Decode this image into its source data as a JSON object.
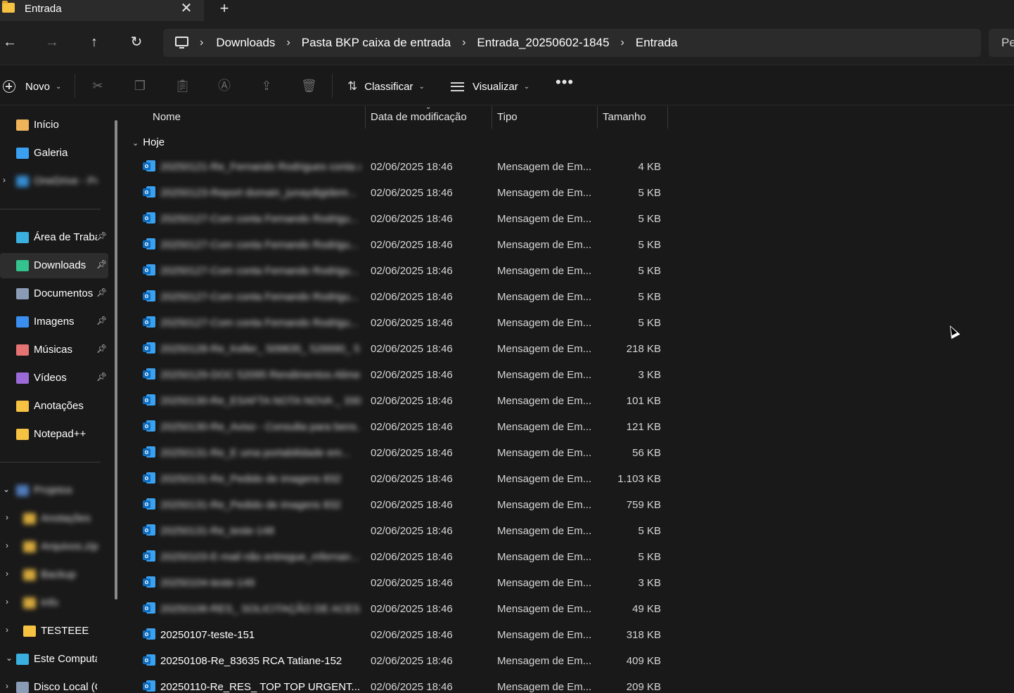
{
  "window": {
    "title": "Entrada",
    "close_glyph": "✕",
    "new_tab_glyph": "+"
  },
  "nav": {
    "back": "←",
    "forward": "→",
    "up": "↑",
    "refresh": "↻"
  },
  "breadcrumb": {
    "sep": "›",
    "items": [
      "Downloads",
      "Pasta BKP caixa de entrada",
      "Entrada_20250602-1845",
      "Entrada"
    ]
  },
  "search": {
    "placeholder_visible": "Pe"
  },
  "toolbar": {
    "new_label": "Novo",
    "sort_label": "Classificar",
    "view_label": "Visualizar",
    "more_glyph": "•••",
    "icons": [
      "cut-icon",
      "copy-icon",
      "paste-icon",
      "rename-icon",
      "share-icon",
      "delete-icon"
    ]
  },
  "sidebar": {
    "items": [
      {
        "label": "Início",
        "icon": "home-icon",
        "color": "#f0b35a"
      },
      {
        "label": "Galeria",
        "icon": "gallery-icon",
        "color": "#3aa0f0"
      },
      {
        "label": "OneDrive - Pessoal",
        "icon": "cloud-icon",
        "color": "#3aa0f0",
        "blurred": true
      },
      {
        "label": "Área de Trabalho",
        "icon": "desktop-icon",
        "color": "#3ab0e0",
        "pinned": true
      },
      {
        "label": "Downloads",
        "icon": "download-icon",
        "color": "#34c38f",
        "pinned": true,
        "active": true
      },
      {
        "label": "Documentos",
        "icon": "document-icon",
        "color": "#8a9bb5",
        "pinned": true
      },
      {
        "label": "Imagens",
        "icon": "image-icon",
        "color": "#3a8ef0",
        "pinned": true
      },
      {
        "label": "Músicas",
        "icon": "music-icon",
        "color": "#e57373",
        "pinned": true
      },
      {
        "label": "Vídeos",
        "icon": "video-icon",
        "color": "#9c6ad8",
        "pinned": true
      },
      {
        "label": "Anotações",
        "icon": "folder-icon",
        "color": "#f5c242"
      },
      {
        "label": "Notepad++",
        "icon": "folder-icon",
        "color": "#f5c242"
      },
      {
        "label": "Projetos",
        "icon": "folder-icon",
        "color": "#5a8cd8",
        "blurred": true
      },
      {
        "label": "Anotações",
        "icon": "folder-icon",
        "color": "#f5c242",
        "blurred": true
      },
      {
        "label": "Arquivos.zip",
        "icon": "folder-icon",
        "color": "#f5c242",
        "blurred": true
      },
      {
        "label": "Backup",
        "icon": "folder-icon",
        "color": "#f5c242",
        "blurred": true
      },
      {
        "label": "Info",
        "icon": "folder-icon",
        "color": "#f5c242",
        "blurred": true
      },
      {
        "label": "TESTEEE",
        "icon": "folder-icon",
        "color": "#f5c242"
      },
      {
        "label": "Este Computador",
        "icon": "computer-icon",
        "color": "#3ab0e0"
      },
      {
        "label": "Disco Local (C:)",
        "icon": "drive-icon",
        "color": "#8a9bb5"
      }
    ]
  },
  "columns": {
    "name": "Nome",
    "date": "Data de modificação",
    "type": "Tipo",
    "size": "Tamanho"
  },
  "group": {
    "label": "Hoje"
  },
  "files": [
    {
      "name": "20250121-Re_Fernando Rodrigues conta at...",
      "date": "02/06/2025 18:46",
      "type": "Mensagem de Em...",
      "size": "4 KB",
      "blurred": true
    },
    {
      "name": "20250123-Report domain_junaydigidem...",
      "date": "02/06/2025 18:46",
      "type": "Mensagem de Em...",
      "size": "5 KB",
      "blurred": true
    },
    {
      "name": "20250127-Com conta Fernando Rodrigu...",
      "date": "02/06/2025 18:46",
      "type": "Mensagem de Em...",
      "size": "5 KB",
      "blurred": true
    },
    {
      "name": "20250127-Com conta Fernando Rodrigu...",
      "date": "02/06/2025 18:46",
      "type": "Mensagem de Em...",
      "size": "5 KB",
      "blurred": true
    },
    {
      "name": "20250127-Com conta Fernando Rodrigu...",
      "date": "02/06/2025 18:46",
      "type": "Mensagem de Em...",
      "size": "5 KB",
      "blurred": true
    },
    {
      "name": "20250127-Com conta Fernando Rodrigu...",
      "date": "02/06/2025 18:46",
      "type": "Mensagem de Em...",
      "size": "5 KB",
      "blurred": true
    },
    {
      "name": "20250127-Com conta Fernando Rodrigu...",
      "date": "02/06/2025 18:46",
      "type": "Mensagem de Em...",
      "size": "5 KB",
      "blurred": true
    },
    {
      "name": "20250128-Re_Keller_ 509835_ 526690_ 5...",
      "date": "02/06/2025 18:46",
      "type": "Mensagem de Em...",
      "size": "218 KB",
      "blurred": true
    },
    {
      "name": "20250129-DOC 52095 Rendimentos Alimentl...",
      "date": "02/06/2025 18:46",
      "type": "Mensagem de Em...",
      "size": "3 KB",
      "blurred": true
    },
    {
      "name": "20250130-Re_ESAFTA NOTA NOVA _ 3304T...",
      "date": "02/06/2025 18:46",
      "type": "Mensagem de Em...",
      "size": "101 KB",
      "blurred": true
    },
    {
      "name": "20250130-Re_Aviso - Consulta para bens...",
      "date": "02/06/2025 18:46",
      "type": "Mensagem de Em...",
      "size": "121 KB",
      "blurred": true
    },
    {
      "name": "20250131-Re_E uma portabilidade em...",
      "date": "02/06/2025 18:46",
      "type": "Mensagem de Em...",
      "size": "56 KB",
      "blurred": true
    },
    {
      "name": "20250131-Re_Pedido de imagens 832",
      "date": "02/06/2025 18:46",
      "type": "Mensagem de Em...",
      "size": "1.103 KB",
      "blurred": true
    },
    {
      "name": "20250131-Re_Pedido de imagens 832",
      "date": "02/06/2025 18:46",
      "type": "Mensagem de Em...",
      "size": "759 KB",
      "blurred": true
    },
    {
      "name": "20250131-Re_teste-148",
      "date": "02/06/2025 18:46",
      "type": "Mensagem de Em...",
      "size": "5 KB",
      "blurred": true
    },
    {
      "name": "20250103-E-mail não entregue_mfernan...",
      "date": "02/06/2025 18:46",
      "type": "Mensagem de Em...",
      "size": "5 KB",
      "blurred": true
    },
    {
      "name": "20250104-teste-149",
      "date": "02/06/2025 18:46",
      "type": "Mensagem de Em...",
      "size": "3 KB",
      "blurred": true
    },
    {
      "name": "20250106-RES_ SOLICITAÇÃO DE ACESSO...",
      "date": "02/06/2025 18:46",
      "type": "Mensagem de Em...",
      "size": "49 KB",
      "blurred": true
    },
    {
      "name": "20250107-teste-151",
      "date": "02/06/2025 18:46",
      "type": "Mensagem de Em...",
      "size": "318 KB"
    },
    {
      "name": "20250108-Re_83635 RCA Tatiane-152",
      "date": "02/06/2025 18:46",
      "type": "Mensagem de Em...",
      "size": "409 KB"
    },
    {
      "name": "20250110-Re_RES_ TOP TOP URGENT...",
      "date": "02/06/2025 18:46",
      "type": "Mensagem de Em...",
      "size": "209 KB"
    }
  ]
}
